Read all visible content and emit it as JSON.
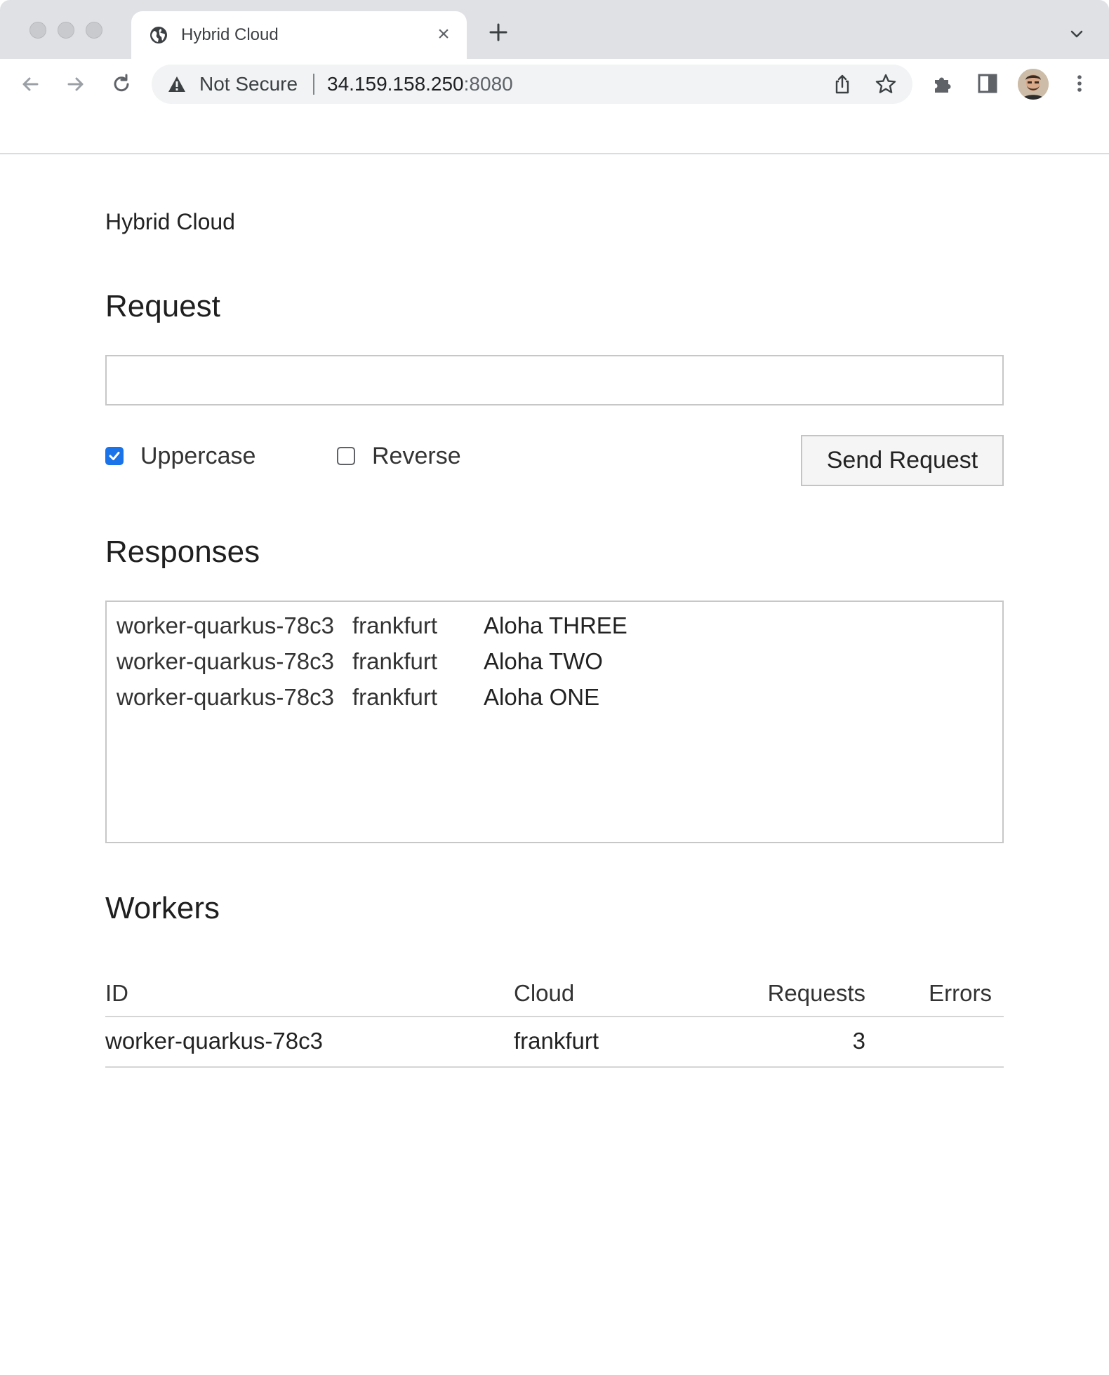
{
  "browser": {
    "tab_title": "Hybrid Cloud",
    "tab_close": "×",
    "security_label": "Not Secure",
    "url_host": "34.159.158.250",
    "url_port": ":8080"
  },
  "page": {
    "app_title": "Hybrid Cloud",
    "request_heading": "Request",
    "request_input_value": "",
    "uppercase_label": "Uppercase",
    "uppercase_checked": true,
    "reverse_label": "Reverse",
    "reverse_checked": false,
    "send_button": "Send Request",
    "responses_heading": "Responses",
    "responses": [
      {
        "worker": "worker-quarkus-78c3",
        "cloud": "frankfurt",
        "message": "Aloha THREE"
      },
      {
        "worker": "worker-quarkus-78c3",
        "cloud": "frankfurt",
        "message": "Aloha TWO"
      },
      {
        "worker": "worker-quarkus-78c3",
        "cloud": "frankfurt",
        "message": "Aloha ONE"
      }
    ],
    "workers_heading": "Workers",
    "workers_table": {
      "columns": [
        "ID",
        "Cloud",
        "Requests",
        "Errors"
      ],
      "rows": [
        {
          "id": "worker-quarkus-78c3",
          "cloud": "frankfurt",
          "requests": "3",
          "errors": ""
        }
      ]
    }
  },
  "colors": {
    "checkbox_accent": "#1a73e8",
    "tab_strip": "#dfe1e5",
    "omnibox": "#f1f3f4"
  }
}
